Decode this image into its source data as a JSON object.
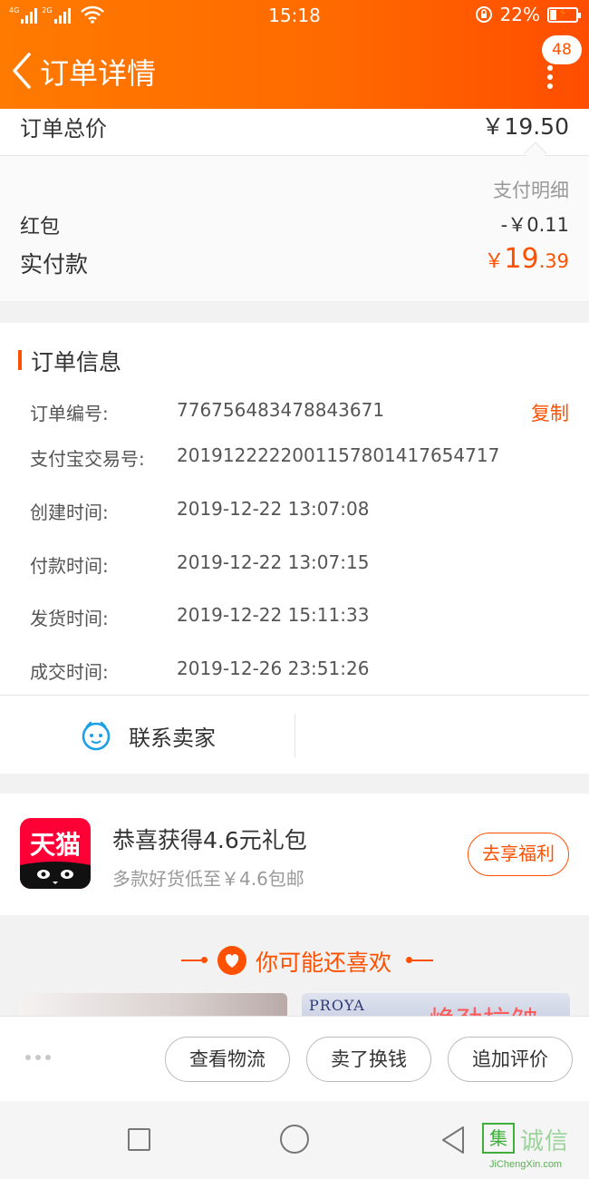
{
  "status_bar": {
    "network_1": "4G",
    "network_2": "2G",
    "time": "15:18",
    "battery": "22%"
  },
  "navbar": {
    "title": "订单详情",
    "message_count": "48"
  },
  "price": {
    "total_label": "订单总价",
    "total_value": "￥19.50",
    "pay_detail_label": "支付明细",
    "hongbao_label": "红包",
    "hongbao_value": "-￥0.11",
    "paid_label": "实付款",
    "paid_currency": "￥",
    "paid_integer": "19",
    "paid_decimal": ".39"
  },
  "order_info": {
    "title": "订单信息",
    "copy_label": "复制",
    "rows": [
      {
        "key": "订单编号:",
        "value": "776756483478843671"
      },
      {
        "key": "支付宝交易号:",
        "value": "2019122222001157801417654717"
      },
      {
        "key": "创建时间:",
        "value": "2019-12-22 13:07:08"
      },
      {
        "key": "付款时间:",
        "value": "2019-12-22 13:07:15"
      },
      {
        "key": "发货时间:",
        "value": "2019-12-22 15:11:33"
      },
      {
        "key": "成交时间:",
        "value": "2019-12-26 23:51:26"
      }
    ]
  },
  "contact": {
    "label": "联系卖家"
  },
  "promo": {
    "logo_text": "天猫",
    "title": "恭喜获得4.6元礼包",
    "subtitle": "多款好货低至￥4.6包邮",
    "button": "去享福利"
  },
  "recommend": {
    "title": "你可能还喜欢",
    "card_2_brand": "PROYA",
    "card_2_text": "焕劲抗皱"
  },
  "actions": {
    "logistics": "查看物流",
    "resell": "卖了换钱",
    "review": "追加评价"
  },
  "watermark": {
    "box": "集",
    "text": "诚信",
    "sub": "JiChengXin.com"
  },
  "colors": {
    "accent": "#ff5000",
    "header_start": "#ff7a00",
    "header_end": "#ff4d00",
    "tmall_red": "#ff0036"
  }
}
